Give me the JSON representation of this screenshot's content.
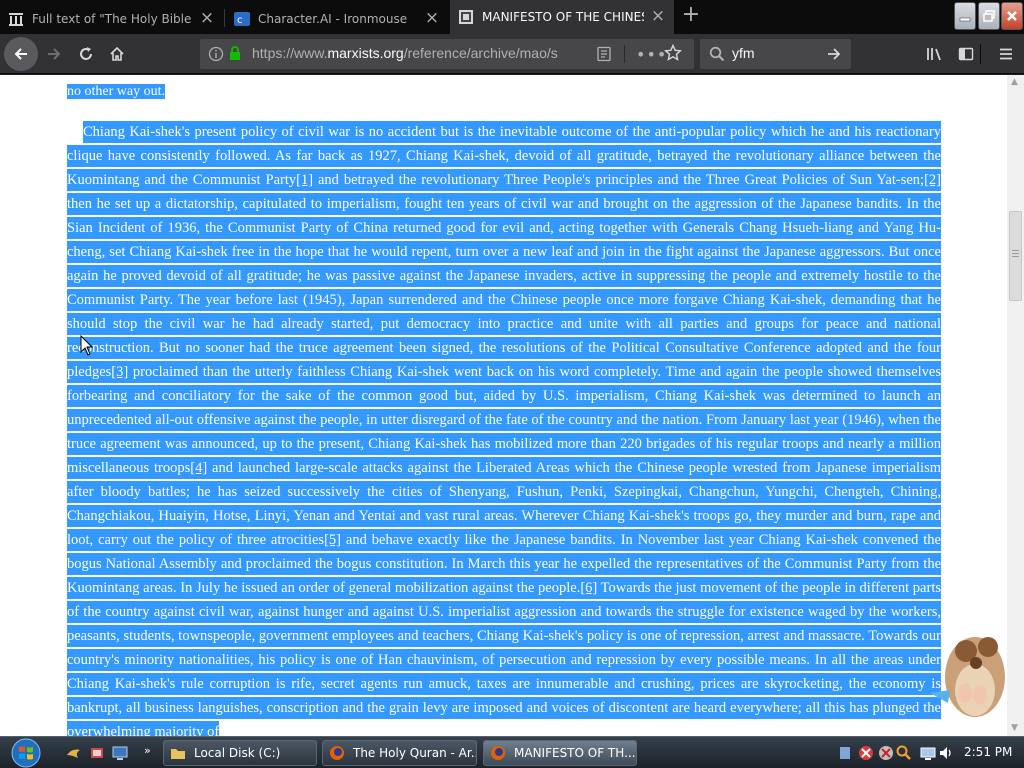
{
  "browser": {
    "tabs": [
      {
        "title": "Full text of \"The Holy Bible con",
        "icon": "archive-icon",
        "active": false
      },
      {
        "title": "Character.AI - Ironmouse",
        "icon": "character-ai-icon",
        "active": false
      },
      {
        "title": "MANIFESTO OF THE CHINESE",
        "icon": "marxists-icon",
        "active": true
      }
    ],
    "url_prefix": "https://www.",
    "url_domain": "marxists.org",
    "url_path": "/reference/archive/mao/s",
    "search_value": "yfm"
  },
  "document": {
    "prev_line": "no other way out.",
    "paragraph": [
      {
        "t": "Chiang Kai-shek's present policy of civil war is no accident but is the inevitable outcome of the anti-popular policy which he and his reactionary clique have consistently followed. As far back as 1927, Chiang Kai-shek, devoid of all gratitude, betrayed the revolutionary alliance between the Kuomintang and the Communist Party"
      },
      {
        "fn": "[1]"
      },
      {
        "t": " and betrayed the revolutionary Three People's principles and the Three Great Policies of Sun Yat-sen;"
      },
      {
        "fn": "[2]"
      },
      {
        "t": " then he set up a dictatorship, capitulated to imperialism, fought ten years of civil war and brought on the aggression of the Japanese bandits. In the Sian Incident of 1936, the Communist Party of China returned good for evil and, acting together with Generals Chang Hsueh-liang and Yang Hu-cheng, set Chiang Kai-shek free in the hope that he would repent, turn over a new leaf and join in the fight against the Japanese aggressors. But once again he proved devoid of all gratitude; he was passive against the Japanese invaders, active in suppressing the people and extremely hostile to the Communist Party. The year before last (1945), Japan surrendered and the Chinese people once more forgave Chiang Kai-shek, demanding that he should stop the civil war he had already started, put democracy into practice and unite with all parties and groups for peace and national reconstruction. But no sooner had the truce agreement been signed, the resolutions of the Political Consultative Conference adopted and the four pledges"
      },
      {
        "fn": "[3]"
      },
      {
        "t": " proclaimed than the utterly faithless Chiang Kai-shek went back on his word completely. Time and again the people showed themselves forbearing and conciliatory for the sake of the common good but, aided by U.S. imperialism, Chiang Kai-shek was determined to launch an unprecedented all-out offensive against the people, in utter disregard of the fate of the country and the nation. From January last year (1946), when the truce agreement was announced, up to the present, Chiang Kai-shek has mobilized more than 220 brigades of his regular troops and nearly a million miscellaneous troops"
      },
      {
        "fn": "[4]"
      },
      {
        "t": " and launched large-scale attacks against the Liberated Areas which the Chinese people wrested from Japanese imperialism after bloody battles; he has seized successively the cities of Shenyang, Fushun, Penki, Szepingkai, Changchun, Yungchi, Chengteh, Chining, Changchiakou, Huaiyin, Hotse, Linyi, Yenan and Yentai and vast rural areas. Wherever Chiang Kai-shek's troops go, they murder and burn, rape and loot, carry out the policy of three atrocities"
      },
      {
        "fn": "[5]"
      },
      {
        "t": " and behave exactly like the Japanese bandits. In November last year Chiang Kai-shek convened the bogus National Assembly and proclaimed the bogus constitution. In March this year he expelled the representatives of the Communist Party from the Kuomintang areas. In July he issued an order of general mobilization against the people."
      },
      {
        "fn": "[6]"
      },
      {
        "t": " Towards the just movement of the people in different parts of the country against civil war, against hunger and against U.S. imperialist aggression and towards the struggle for existence waged by the workers, peasants, students, townspeople, government employees and teachers, Chiang Kai-shek's policy is one of repression, arrest and massacre. Towards our country's minority nationalities, his policy is one of Han chauvinism, of persecution and repression by every possible means. In all the areas under Chiang Kai-shek's rule corruption is rife, secret agents run amuck, taxes are innumerable and crushing, prices are skyrocketing, the economy is bankrupt, all business languishes, conscription and the grain levy are imposed and voices of discontent are heard everywhere; all this has plunged the overwhelming majority of"
      }
    ]
  },
  "taskbar": {
    "tasks": [
      {
        "label": "Local Disk (C:)",
        "icon": "folder-icon"
      },
      {
        "label": "The Holy Quran - Ar...",
        "icon": "firefox-icon"
      },
      {
        "label": "MANIFESTO OF TH...",
        "icon": "firefox-icon"
      }
    ],
    "clock": "2:51 PM"
  },
  "colors": {
    "selection": "#3399ff",
    "tabstrip": "#0c0c0d",
    "toolbar": "#323234"
  }
}
